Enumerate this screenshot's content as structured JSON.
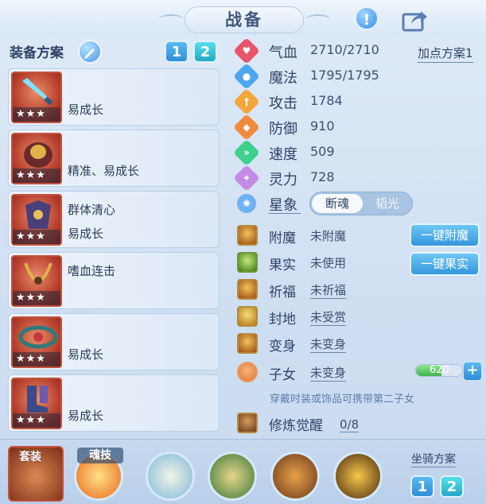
{
  "header": {
    "title": "战备"
  },
  "left": {
    "title": "装备方案",
    "plan_buttons": [
      "1",
      "2"
    ],
    "items": [
      {
        "stars": "★★★",
        "line1": "",
        "line2": "易成长"
      },
      {
        "stars": "★★★",
        "line1": "",
        "line2": "精准、易成长"
      },
      {
        "stars": "★★★",
        "line1": "群体清心",
        "line2": "易成长"
      },
      {
        "stars": "★★★",
        "line1": "嗜血连击",
        "line2": ""
      },
      {
        "stars": "★★★",
        "line1": "",
        "line2": "易成长"
      },
      {
        "stars": "★★★",
        "line1": "",
        "line2": "易成长"
      }
    ]
  },
  "stats": {
    "plan_link": "加点方案1",
    "rows": [
      {
        "name": "气血",
        "value": "2710/2710",
        "icon": "heart-icon",
        "color": "#e8556a"
      },
      {
        "name": "魔法",
        "value": "1795/1795",
        "icon": "mana-icon",
        "color": "#4ea6ee"
      },
      {
        "name": "攻击",
        "value": "1784",
        "icon": "attack-icon",
        "color": "#f2a73a"
      },
      {
        "name": "防御",
        "value": "910",
        "icon": "defense-icon",
        "color": "#f08a3e"
      },
      {
        "name": "速度",
        "value": "509",
        "icon": "speed-icon",
        "color": "#3fcf8e"
      },
      {
        "name": "灵力",
        "value": "728",
        "icon": "spirit-icon",
        "color": "#c58ae6"
      }
    ],
    "star": {
      "name": "星象",
      "option_a": "断魂",
      "option_b": "韬光"
    }
  },
  "buffs": {
    "rows": [
      {
        "name": "附魔",
        "value": "未附魔"
      },
      {
        "name": "果实",
        "value": "未使用"
      },
      {
        "name": "祈福",
        "value": "未祈福"
      },
      {
        "name": "封地",
        "value": "未受赏"
      },
      {
        "name": "变身",
        "value": "未变身"
      },
      {
        "name": "子女",
        "value": "未变身"
      }
    ],
    "btn_enchant": "一键附魔",
    "btn_fruit": "一键果实",
    "child_value": "620",
    "child_fill": 0.55,
    "hint": "穿戴时装或饰品可携带第二子女",
    "train_label": "修炼觉醒",
    "train_value": "0/8"
  },
  "bottom": {
    "suit_label": "套装",
    "skill_label": "魂技",
    "mount_label": "坐骑方案",
    "mount_buttons": [
      "1",
      "2"
    ]
  }
}
